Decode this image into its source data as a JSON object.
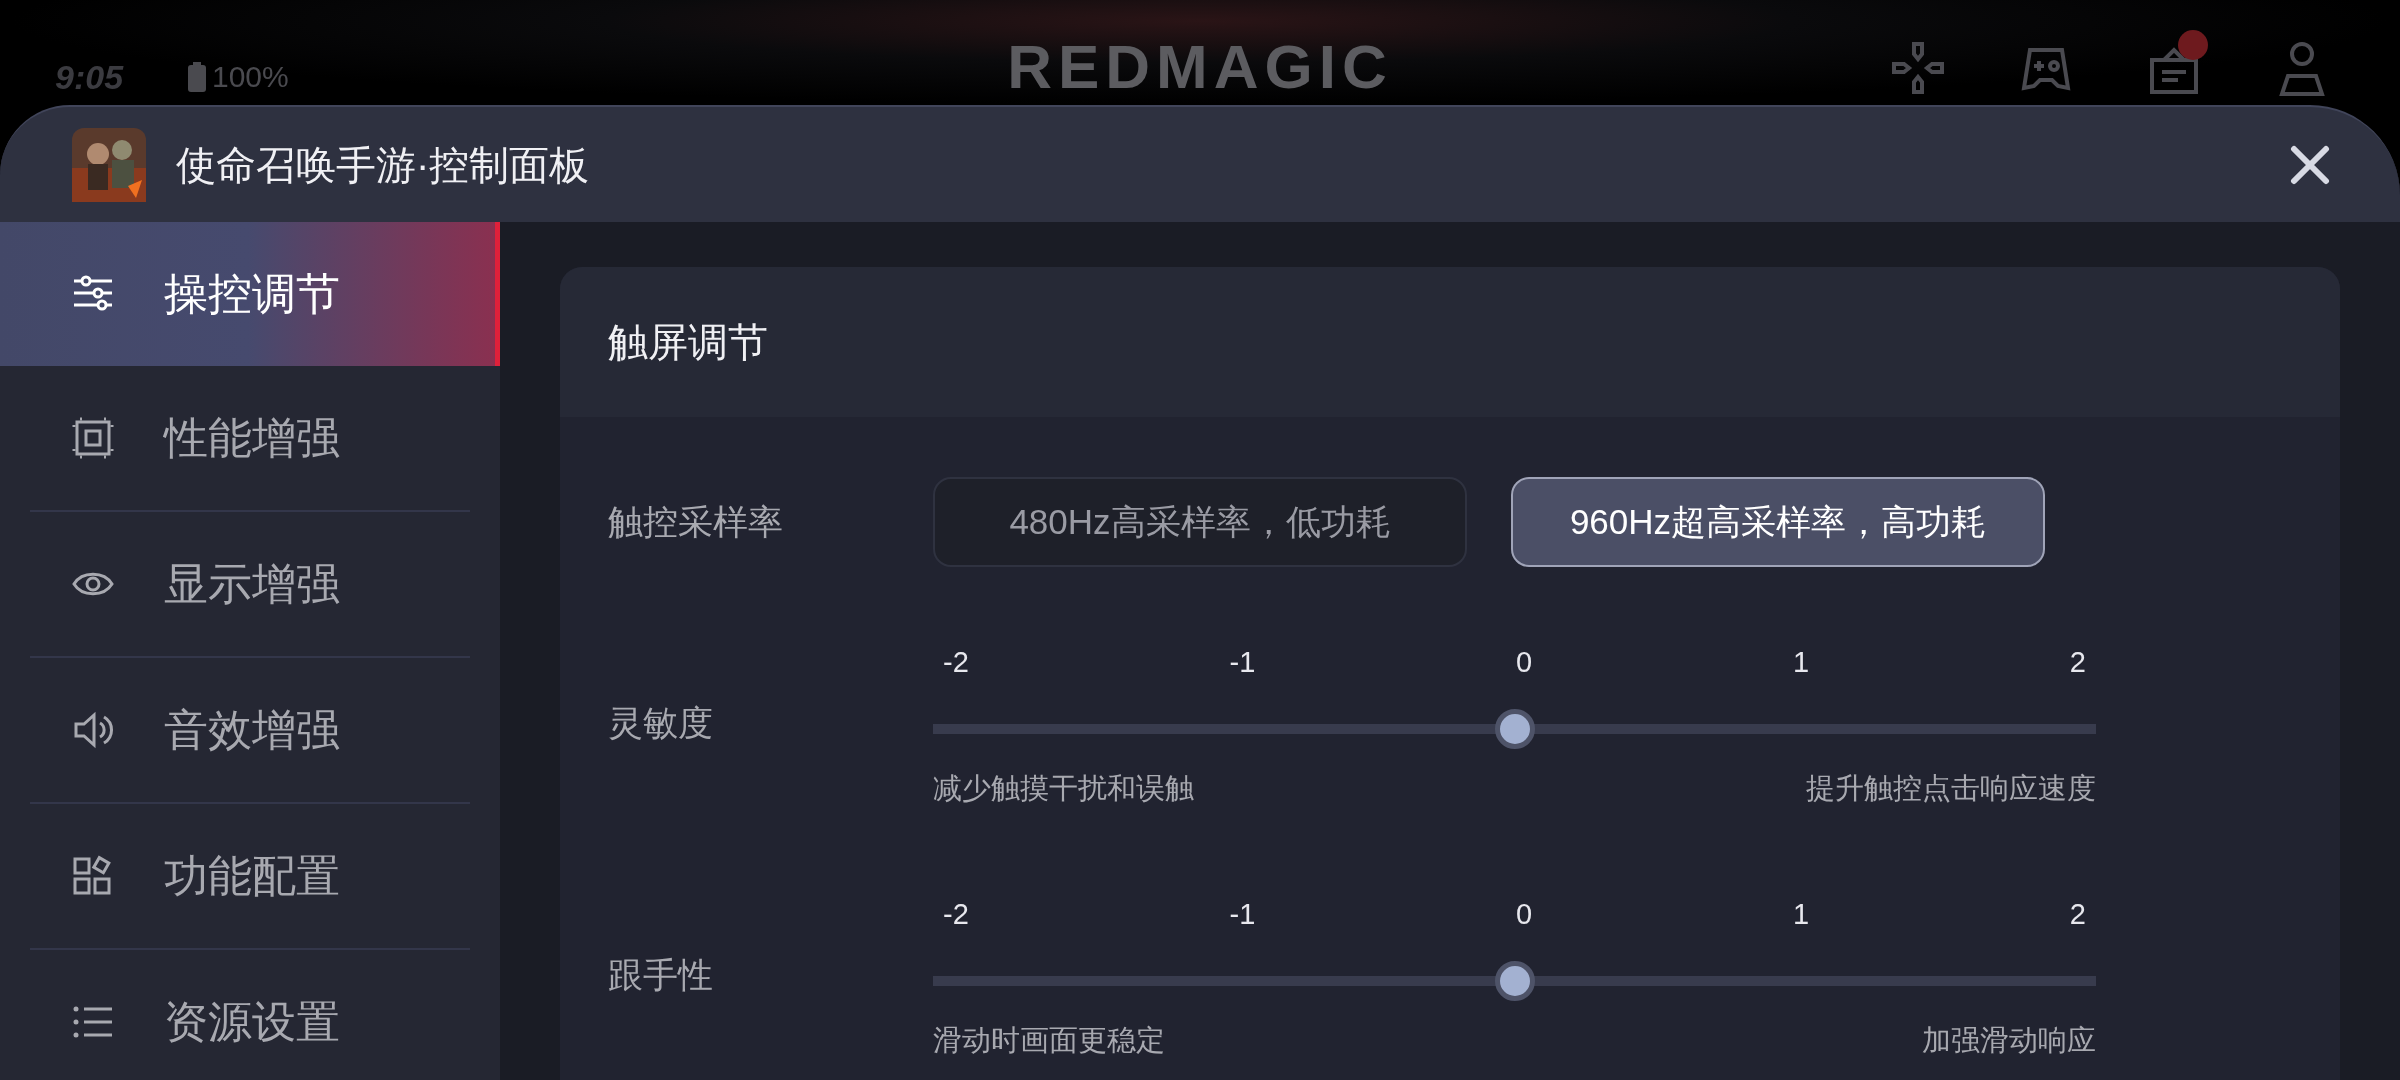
{
  "status_bar": {
    "time": "9:05",
    "battery": "100%"
  },
  "logo": "REDMAGIC",
  "top_icons": [
    {
      "badge": false
    },
    {
      "badge": false
    },
    {
      "badge": true
    },
    {
      "badge": false
    }
  ],
  "window": {
    "title": "使命召唤手游·控制面板"
  },
  "sidebar": {
    "items": [
      {
        "label": "操控调节",
        "selected": true
      },
      {
        "label": "性能增强",
        "selected": false
      },
      {
        "label": "显示增强",
        "selected": false
      },
      {
        "label": "音效增强",
        "selected": false
      },
      {
        "label": "功能配置",
        "selected": false
      },
      {
        "label": "资源设置",
        "selected": false
      }
    ]
  },
  "card": {
    "title": "触屏调节",
    "sampling": {
      "label": "触控采样率",
      "options": [
        {
          "label": "480Hz高采样率，低功耗",
          "selected": false
        },
        {
          "label": "960Hz超高采样率，高功耗",
          "selected": true
        }
      ]
    },
    "sliders": [
      {
        "label": "灵敏度",
        "ticks": [
          "-2",
          "-1",
          "0",
          "1",
          "2"
        ],
        "level": 0.5,
        "min_caption": "减少触摸干扰和误触",
        "max_caption": "提升触控点击响应速度"
      },
      {
        "label": "跟手性",
        "ticks": [
          "-2",
          "-1",
          "0",
          "1",
          "2"
        ],
        "level": 0.5,
        "min_caption": "滑动时画面更稳定",
        "max_caption": "加强滑动响应"
      }
    ]
  }
}
